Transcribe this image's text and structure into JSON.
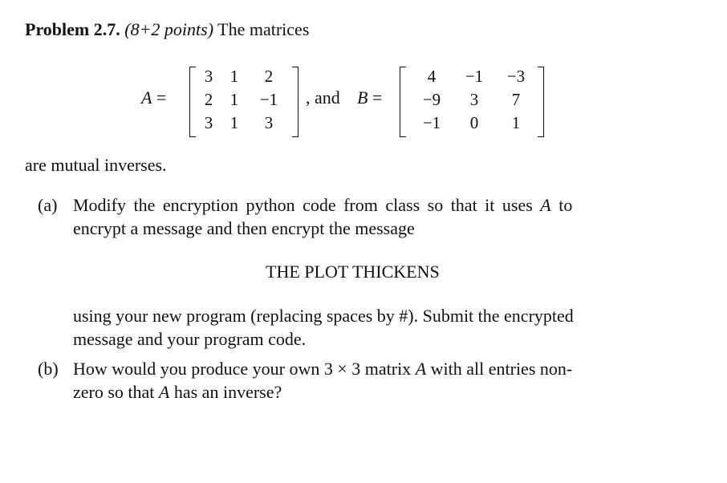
{
  "problem": {
    "label": "Problem 2.7.",
    "points": "(8+2 points)",
    "intro": "The matrices"
  },
  "matrices": {
    "A": {
      "name": "A",
      "equals": " =",
      "rows": [
        [
          "3",
          "1",
          "2"
        ],
        [
          "2",
          "1",
          "−1"
        ],
        [
          "3",
          "1",
          "3"
        ]
      ]
    },
    "connector": ", and ",
    "B": {
      "name": "B",
      "equals": " =",
      "rows": [
        [
          "4",
          "−1",
          "−3"
        ],
        [
          "−9",
          "3",
          "7"
        ],
        [
          "−1",
          "0",
          "1"
        ]
      ]
    }
  },
  "statement_end": "are mutual inverses.",
  "part_a": {
    "label": "(a)",
    "line1_pre": "Modify the encryption python code from class so that it uses ",
    "line1_var": "A",
    "line1_post": " to",
    "line2": "encrypt a message and then encrypt the message",
    "message": "THE PLOT THICKENS",
    "line3": "using your new program (replacing spaces by #). Submit the encrypted",
    "line4": "message and your program code."
  },
  "part_b": {
    "label": "(b)",
    "line1_pre": "How would you produce your own 3 × 3 matrix ",
    "line1_var": "A",
    "line1_post": " with all entries non-",
    "line2_pre": "zero so that ",
    "line2_var": "A",
    "line2_post": " has an inverse?"
  }
}
